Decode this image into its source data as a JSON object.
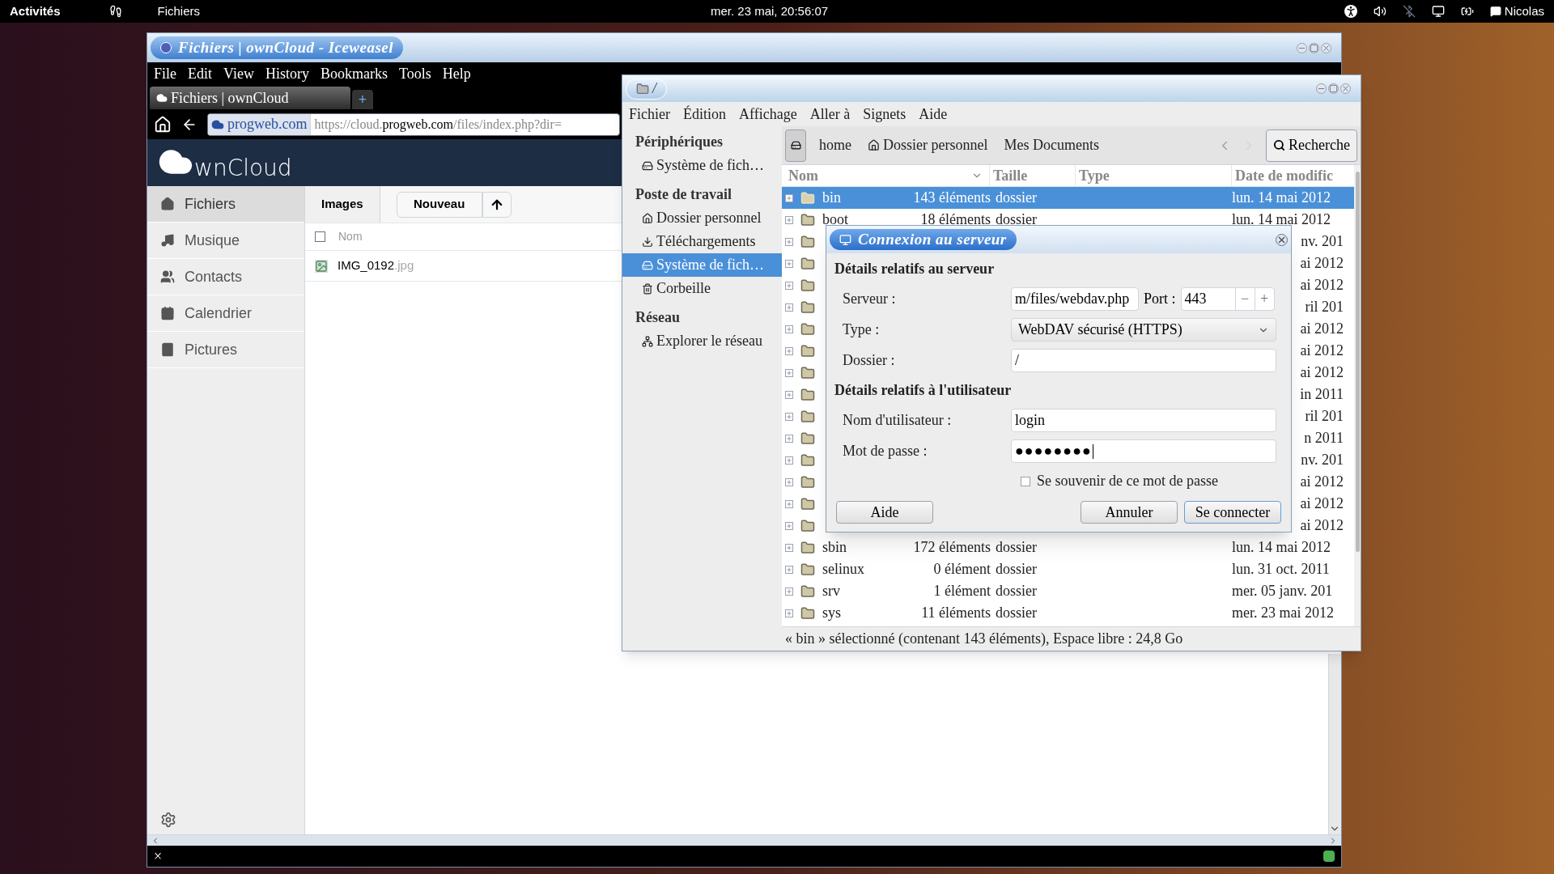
{
  "top_bar": {
    "activities": "Activités",
    "app": "Fichiers",
    "clock": "mer. 23 mai, 20:56:07",
    "user": "Nicolas"
  },
  "browser": {
    "title": "Fichiers | ownCloud - Iceweasel",
    "menu": [
      "File",
      "Edit",
      "View",
      "History",
      "Bookmarks",
      "Tools",
      "Help"
    ],
    "tabs": [
      {
        "label": "Fichiers | ownCloud",
        "selected": true
      }
    ],
    "new_tab": "+",
    "url": {
      "site": "progweb.com",
      "prefix": "https://cloud.",
      "domain": "progweb.com",
      "rest": "/files/index.php?dir="
    },
    "status_close": "×"
  },
  "owncloud": {
    "logo_text": "wnCloud",
    "nav": [
      {
        "label": "Fichiers",
        "selected": true
      },
      {
        "label": "Musique",
        "selected": false
      },
      {
        "label": "Contacts",
        "selected": false
      },
      {
        "label": "Calendrier",
        "selected": false
      },
      {
        "label": "Pictures",
        "selected": false
      }
    ],
    "breadcrumb": "Images",
    "new_button": "Nouveau",
    "column": "Nom",
    "select_all_checked": false,
    "files": [
      {
        "name": "IMG_0192",
        "ext": ".jpg"
      }
    ]
  },
  "file_manager": {
    "title": "/",
    "menu": [
      "Fichier",
      "Édition",
      "Affichage",
      "Aller à",
      "Signets",
      "Aide"
    ],
    "sidebar": [
      {
        "heading": "Périphériques",
        "items": [
          {
            "label": "Système de fich…",
            "selected": false
          }
        ]
      },
      {
        "heading": "Poste de travail",
        "items": [
          {
            "label": "Dossier personnel",
            "selected": false
          },
          {
            "label": "Téléchargements",
            "selected": false
          },
          {
            "label": "Système de fich…",
            "selected": true
          },
          {
            "label": "Corbeille",
            "selected": false
          }
        ]
      },
      {
        "heading": "Réseau",
        "items": [
          {
            "label": "Explorer le réseau",
            "selected": false
          }
        ]
      }
    ],
    "path": [
      "home",
      "Dossier personnel",
      "Mes Documents"
    ],
    "search": "Recherche",
    "columns": [
      "Nom",
      "Taille",
      "Type",
      "Date de modific"
    ],
    "rows": [
      {
        "kind": "full",
        "name": "bin",
        "size": "143 éléments",
        "type": "dossier",
        "date": "lun. 14 mai 2012",
        "selected": true
      },
      {
        "kind": "full",
        "name": "boot",
        "size": "18 éléments",
        "type": "dossier",
        "date": "lun. 14 mai 2012",
        "selected": false
      },
      {
        "kind": "covered",
        "date": "nv. 201",
        "selected": false
      },
      {
        "kind": "covered",
        "date": "ai 2012",
        "selected": false
      },
      {
        "kind": "covered",
        "date": "ai 2012",
        "selected": false
      },
      {
        "kind": "covered",
        "date": "ril 201",
        "selected": false
      },
      {
        "kind": "covered",
        "date": "ai 2012",
        "selected": false
      },
      {
        "kind": "covered",
        "date": "ai 2012",
        "selected": false
      },
      {
        "kind": "covered",
        "date": "ai 2012",
        "selected": false
      },
      {
        "kind": "covered",
        "date": "in 2011",
        "selected": false
      },
      {
        "kind": "covered",
        "date": "ril 201",
        "selected": false
      },
      {
        "kind": "covered",
        "date": "n 2011",
        "selected": false
      },
      {
        "kind": "covered",
        "date": "nv. 201",
        "selected": false
      },
      {
        "kind": "covered",
        "date": "ai 2012",
        "selected": false
      },
      {
        "kind": "covered",
        "date": "ai 2012",
        "selected": false
      },
      {
        "kind": "covered",
        "date": "ai 2012",
        "selected": false
      },
      {
        "kind": "full",
        "name": "sbin",
        "size": "172 éléments",
        "type": "dossier",
        "date": "lun. 14 mai 2012",
        "selected": false
      },
      {
        "kind": "full",
        "name": "selinux",
        "size": "0 élément",
        "type": "dossier",
        "date": "lun. 31 oct. 2011",
        "selected": false
      },
      {
        "kind": "full",
        "name": "srv",
        "size": "1 élément",
        "type": "dossier",
        "date": "mer. 05 janv. 201",
        "selected": false
      },
      {
        "kind": "full",
        "name": "sys",
        "size": "11 éléments",
        "type": "dossier",
        "date": "mer. 23 mai 2012",
        "selected": false
      }
    ],
    "status": "« bin » sélectionné (contenant 143 éléments), Espace libre : 24,8 Go"
  },
  "dialog": {
    "title": "Connexion au serveur",
    "server_heading": "Détails relatifs au serveur",
    "server_label": "Serveur :",
    "server_value": "m/files/webdav.php",
    "port_label": "Port :",
    "port_value": "443",
    "minus": "−",
    "plus": "+",
    "type_label": "Type :",
    "type_value": "WebDAV sécurisé (HTTPS)",
    "folder_label": "Dossier :",
    "folder_value": "/",
    "user_heading": "Détails relatifs à l'utilisateur",
    "user_label": "Nom d'utilisateur :",
    "user_value": "login",
    "password_label": "Mot de passe :",
    "password_value": "●●●●●●●●",
    "remember": {
      "label": "Se souvenir de ce mot de passe",
      "checked": false
    },
    "buttons": [
      {
        "label": "Aide",
        "default": false
      },
      {
        "label": "Annuler",
        "default": false
      },
      {
        "label": "Se connecter",
        "default": true
      }
    ]
  }
}
